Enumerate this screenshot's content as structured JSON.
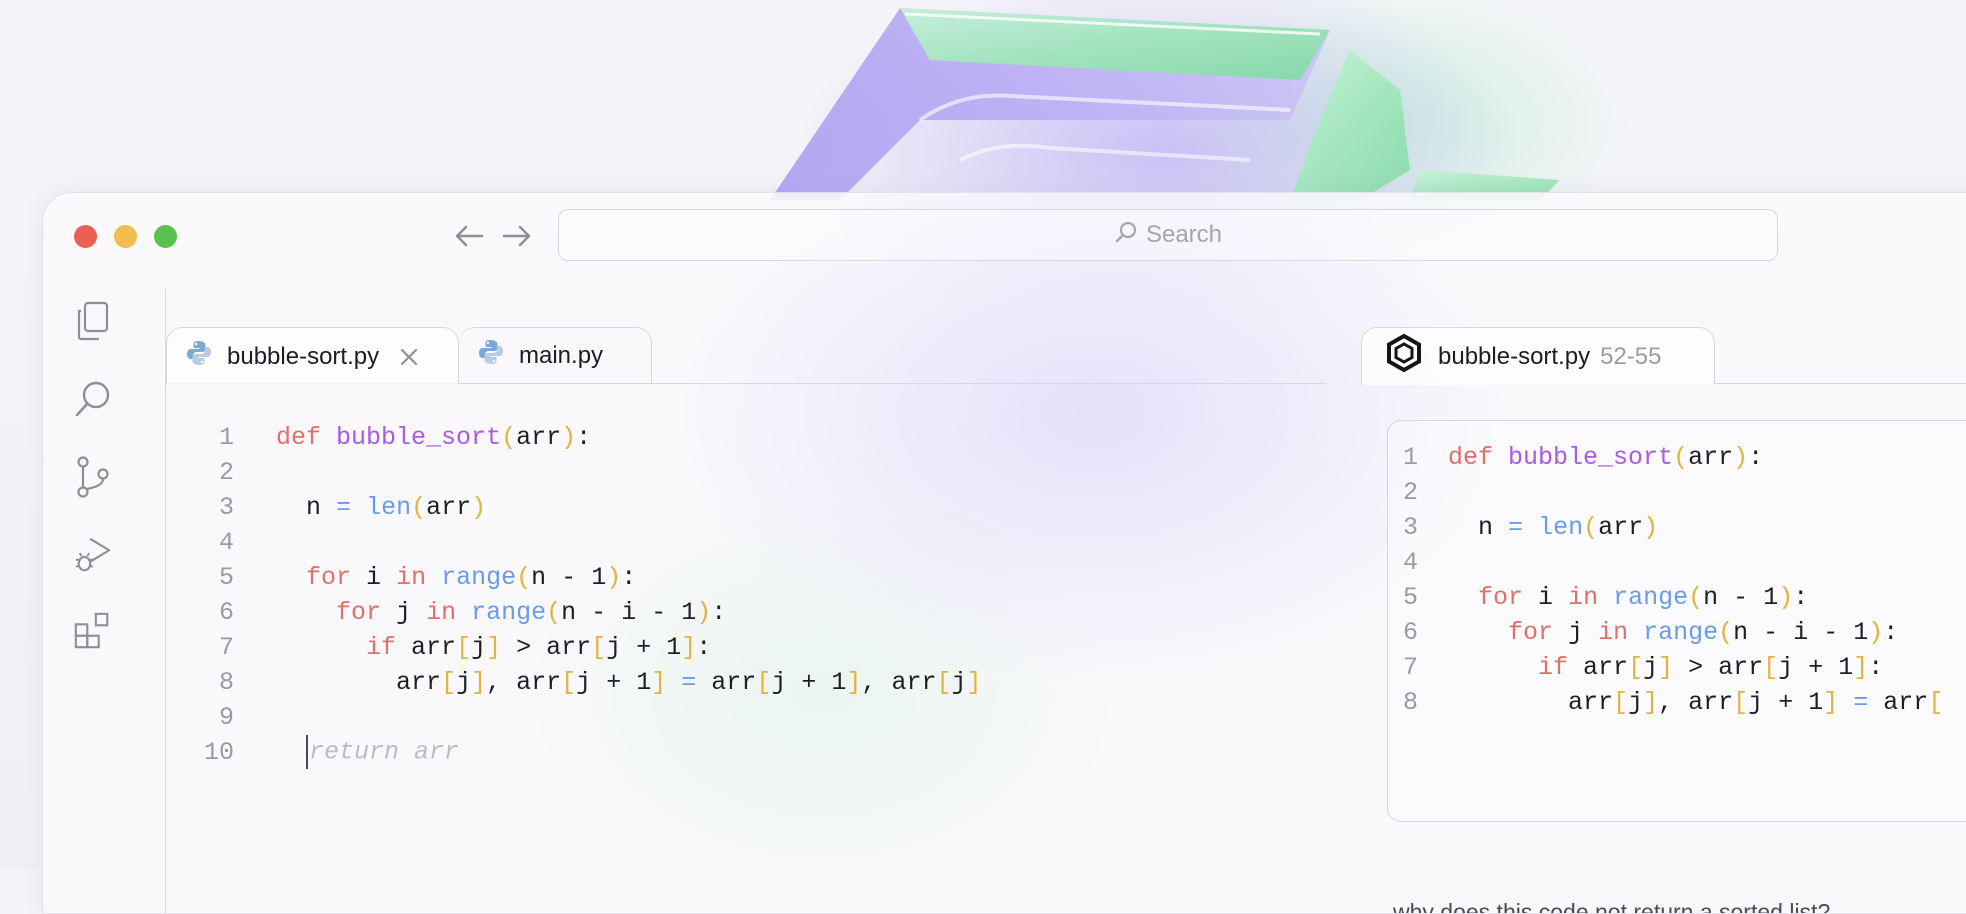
{
  "window": {
    "nav": {
      "back_icon": "arrow-left-icon",
      "forward_icon": "arrow-right-icon"
    },
    "search": {
      "icon": "search-icon",
      "placeholder": "Search"
    }
  },
  "sidebar": {
    "items": [
      {
        "icon": "files-icon"
      },
      {
        "icon": "search-icon"
      },
      {
        "icon": "source-control-icon"
      },
      {
        "icon": "run-debug-icon"
      },
      {
        "icon": "extensions-icon"
      }
    ]
  },
  "editor": {
    "tabs": [
      {
        "label": "bubble-sort.py",
        "icon": "python-icon",
        "active": true,
        "closable": true
      },
      {
        "label": "main.py",
        "icon": "python-icon",
        "active": false
      }
    ],
    "lines": [
      {
        "n": "1",
        "text": "def bubble_sort(arr):"
      },
      {
        "n": "2",
        "text": ""
      },
      {
        "n": "3",
        "text": "  n = len(arr)"
      },
      {
        "n": "4",
        "text": ""
      },
      {
        "n": "5",
        "text": "  for i in range(n - 1):"
      },
      {
        "n": "6",
        "text": "    for j in range(n - i - 1):"
      },
      {
        "n": "7",
        "text": "      if arr[j] > arr[j + 1]:"
      },
      {
        "n": "8",
        "text": "        arr[j], arr[j + 1] = arr[j + 1], arr[j]"
      },
      {
        "n": "9",
        "text": ""
      },
      {
        "n": "10",
        "text": "return arr"
      }
    ]
  },
  "assistant": {
    "tab": {
      "icon": "assistant-logo-icon",
      "label": "bubble-sort.py",
      "range": "52-55"
    },
    "snippet_lines": [
      {
        "n": "1",
        "text": "def bubble_sort(arr):"
      },
      {
        "n": "2",
        "text": ""
      },
      {
        "n": "3",
        "text": "  n = len(arr)"
      },
      {
        "n": "4",
        "text": ""
      },
      {
        "n": "5",
        "text": "  for i in range(n - 1):"
      },
      {
        "n": "6",
        "text": "    for j in range(n - i - 1):"
      },
      {
        "n": "7",
        "text": "      if arr[j] > arr[j + 1]:"
      },
      {
        "n": "8",
        "text": "        arr[j], arr[j + 1] = arr["
      }
    ],
    "question": "why does this code not return a sorted list?"
  },
  "colors": {
    "keyword": "#e0706a",
    "function": "#a85ce0",
    "builtin": "#6a9ce6",
    "bracket": "#e3b43c"
  }
}
